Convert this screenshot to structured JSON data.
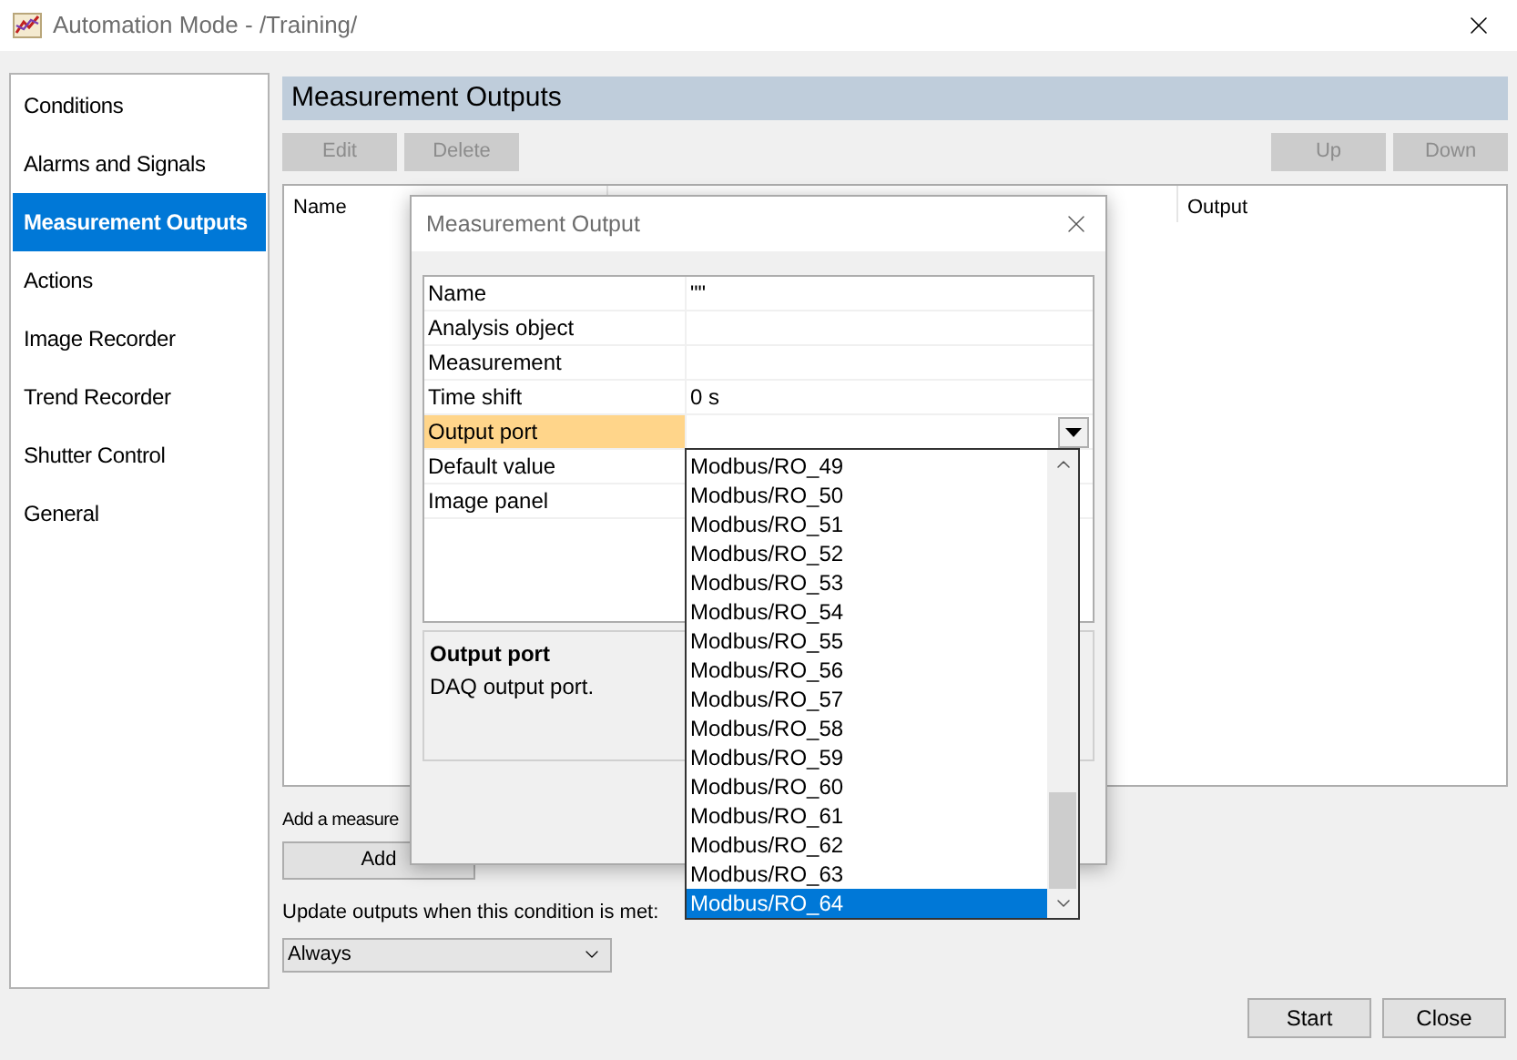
{
  "window": {
    "title": "Automation Mode - /Training/"
  },
  "sidebar": {
    "items": [
      {
        "label": "Conditions",
        "selected": false
      },
      {
        "label": "Alarms and Signals",
        "selected": false
      },
      {
        "label": "Measurement Outputs",
        "selected": true
      },
      {
        "label": "Actions",
        "selected": false
      },
      {
        "label": "Image Recorder",
        "selected": false
      },
      {
        "label": "Trend Recorder",
        "selected": false
      },
      {
        "label": "Shutter Control",
        "selected": false
      },
      {
        "label": "General",
        "selected": false
      }
    ]
  },
  "panel": {
    "title": "Measurement Outputs",
    "left_buttons": [
      {
        "label": "Edit",
        "disabled": true
      },
      {
        "label": "Delete",
        "disabled": true
      }
    ],
    "right_buttons": [
      {
        "label": "Up",
        "disabled": true
      },
      {
        "label": "Down",
        "disabled": true
      }
    ],
    "table": {
      "columns": [
        "Name",
        "Output"
      ]
    },
    "add_label": "Add a measure",
    "add_button": "Add",
    "update_label": "Update outputs when this condition is met:",
    "update_select": {
      "value": "Always"
    }
  },
  "footer_buttons": [
    "Start",
    "Close"
  ],
  "dialog": {
    "title": "Measurement Output",
    "properties": [
      {
        "name": "Name",
        "value": "\"\"",
        "selected": false
      },
      {
        "name": "Analysis object",
        "selected": false
      },
      {
        "name": "Measurement",
        "selected": false
      },
      {
        "name": "Time shift",
        "value": "0 s",
        "selected": false
      },
      {
        "name": "Output port",
        "selected": true
      },
      {
        "name": "Default value",
        "selected": false
      },
      {
        "name": "Image panel",
        "selected": false
      }
    ],
    "description": {
      "title": "Output port",
      "text": "DAQ output port."
    },
    "dropdown": {
      "options": [
        {
          "label": "Modbus/RO_49",
          "selected": false
        },
        {
          "label": "Modbus/RO_50",
          "selected": false
        },
        {
          "label": "Modbus/RO_51",
          "selected": false
        },
        {
          "label": "Modbus/RO_52",
          "selected": false
        },
        {
          "label": "Modbus/RO_53",
          "selected": false
        },
        {
          "label": "Modbus/RO_54",
          "selected": false
        },
        {
          "label": "Modbus/RO_55",
          "selected": false
        },
        {
          "label": "Modbus/RO_56",
          "selected": false
        },
        {
          "label": "Modbus/RO_57",
          "selected": false
        },
        {
          "label": "Modbus/RO_58",
          "selected": false
        },
        {
          "label": "Modbus/RO_59",
          "selected": false
        },
        {
          "label": "Modbus/RO_60",
          "selected": false
        },
        {
          "label": "Modbus/RO_61",
          "selected": false
        },
        {
          "label": "Modbus/RO_62",
          "selected": false
        },
        {
          "label": "Modbus/RO_63",
          "selected": false
        },
        {
          "label": "Modbus/RO_64",
          "selected": true
        }
      ]
    }
  }
}
